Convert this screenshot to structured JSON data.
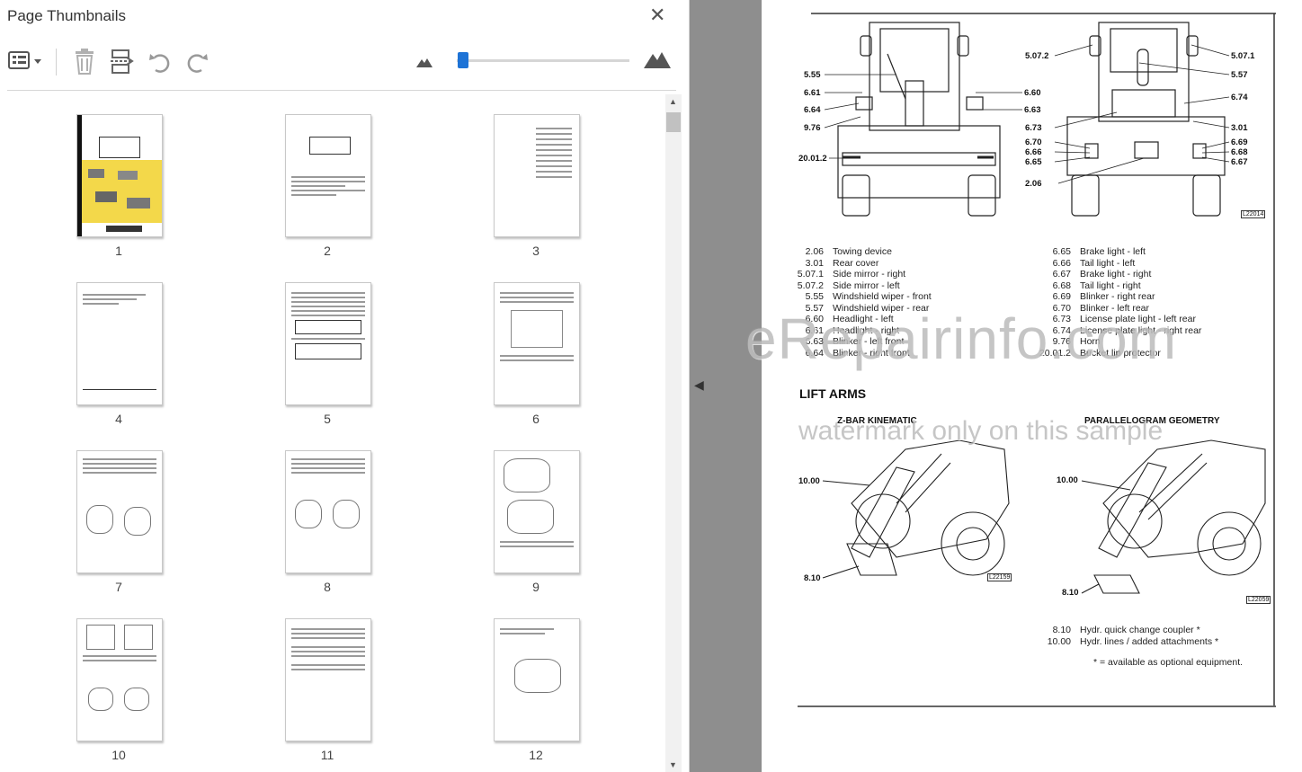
{
  "panel": {
    "title": "Page Thumbnails",
    "close_icon": "close-icon",
    "toolbar": {
      "options_icon": "thumbnail-options-icon",
      "delete_icon": "trash-icon",
      "insert_icon": "insert-pages-icon",
      "rotate_ccw_icon": "rotate-counterclockwise-icon",
      "rotate_cw_icon": "rotate-clockwise-icon",
      "zoom_out_icon": "small-mountain-icon",
      "zoom_in_icon": "large-mountain-icon",
      "zoom_level": 0.0
    },
    "thumbnails": [
      "1",
      "2",
      "3",
      "4",
      "5",
      "6",
      "7",
      "8",
      "9",
      "10",
      "11",
      "12"
    ]
  },
  "document": {
    "callouts_left": [
      "5.55",
      "6.61",
      "6.64",
      "9.76",
      "20.01.2",
      "6.60",
      "6.63"
    ],
    "callouts_right": [
      "5.07.2",
      "5.07.1",
      "5.57",
      "6.74",
      "6.73",
      "3.01",
      "6.70",
      "6.66",
      "6.65",
      "6.69",
      "6.68",
      "6.67",
      "2.06"
    ],
    "figure_ref_top": "L22014",
    "legend_left": [
      {
        "code": "2.06",
        "label": "Towing device"
      },
      {
        "code": "3.01",
        "label": "Rear cover"
      },
      {
        "code": "5.07.1",
        "label": "Side mirror - right"
      },
      {
        "code": "5.07.2",
        "label": "Side mirror - left"
      },
      {
        "code": "5.55",
        "label": "Windshield wiper - front"
      },
      {
        "code": "5.57",
        "label": "Windshield wiper - rear"
      },
      {
        "code": "6.60",
        "label": "Headlight - left"
      },
      {
        "code": "6.61",
        "label": "Headlight - right"
      },
      {
        "code": "6.63",
        "label": "Blinker - left front"
      },
      {
        "code": "6.64",
        "label": "Blinker - right front"
      }
    ],
    "legend_right": [
      {
        "code": "6.65",
        "label": "Brake light - left"
      },
      {
        "code": "6.66",
        "label": "Tail light - left"
      },
      {
        "code": "6.67",
        "label": "Brake light - right"
      },
      {
        "code": "6.68",
        "label": "Tail light - right"
      },
      {
        "code": "6.69",
        "label": "Blinker - right rear"
      },
      {
        "code": "6.70",
        "label": "Blinker - left rear"
      },
      {
        "code": "6.73",
        "label": "License plate light - left rear"
      },
      {
        "code": "6.74",
        "label": "License plate light - right rear"
      },
      {
        "code": "9.76",
        "label": "Horn"
      },
      {
        "code": "20.01.2",
        "label": "Bucket lip protector"
      }
    ],
    "section_title": "LIFT ARMS",
    "subhead_left": "Z-BAR KINEMATIC",
    "subhead_right": "PARALLELOGRAM GEOMETRY",
    "fig_left_labels": [
      "10.00",
      "8.10"
    ],
    "fig_right_labels": [
      "10.00",
      "8.10"
    ],
    "figure_ref_left": "L22159",
    "figure_ref_right": "L22059",
    "legend_bottom": [
      {
        "code": "8.10",
        "label": "Hydr. quick change coupler *"
      },
      {
        "code": "10.00",
        "label": "Hydr. lines / added attachments *"
      }
    ],
    "footnote": "* = available as optional equipment.",
    "watermark_main": "eRepairinfo.com",
    "watermark_sub": "watermark only on this sample"
  }
}
